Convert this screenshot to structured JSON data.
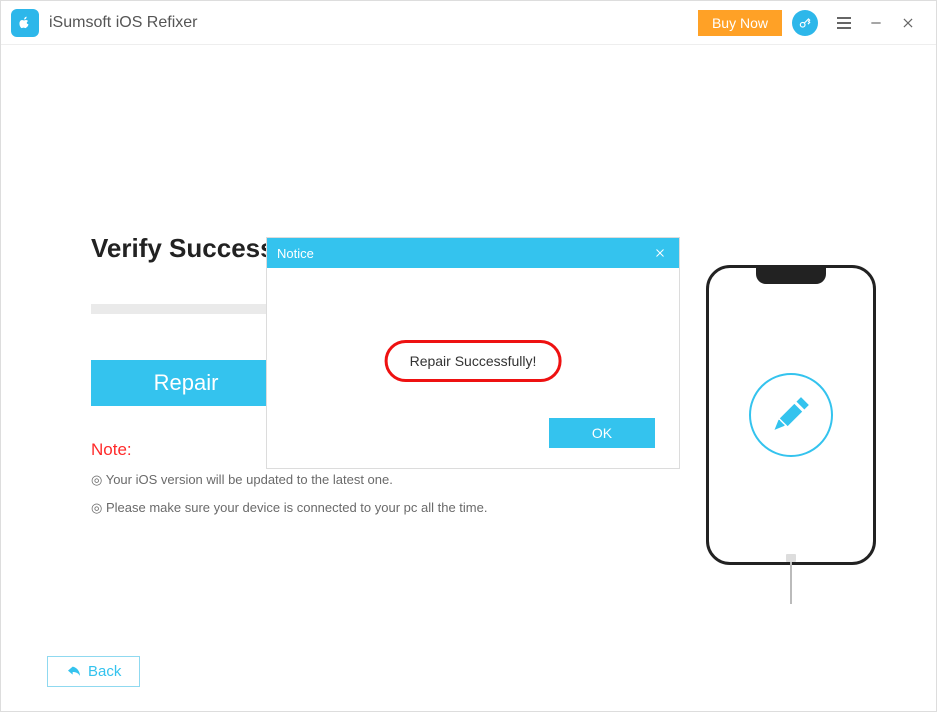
{
  "titlebar": {
    "app_title": "iSumsoft iOS Refixer",
    "buy_now": "Buy Now"
  },
  "main": {
    "heading": "Verify Success",
    "repair_button": "Repair",
    "note_title": "Note:",
    "note_line1": "◎ Your iOS version will be updated to the latest one.",
    "note_line2": "◎ Please make sure your device is connected to your pc all the time."
  },
  "dialog": {
    "title": "Notice",
    "message": "Repair Successfully!",
    "ok": "OK"
  },
  "footer": {
    "back": "Back"
  }
}
